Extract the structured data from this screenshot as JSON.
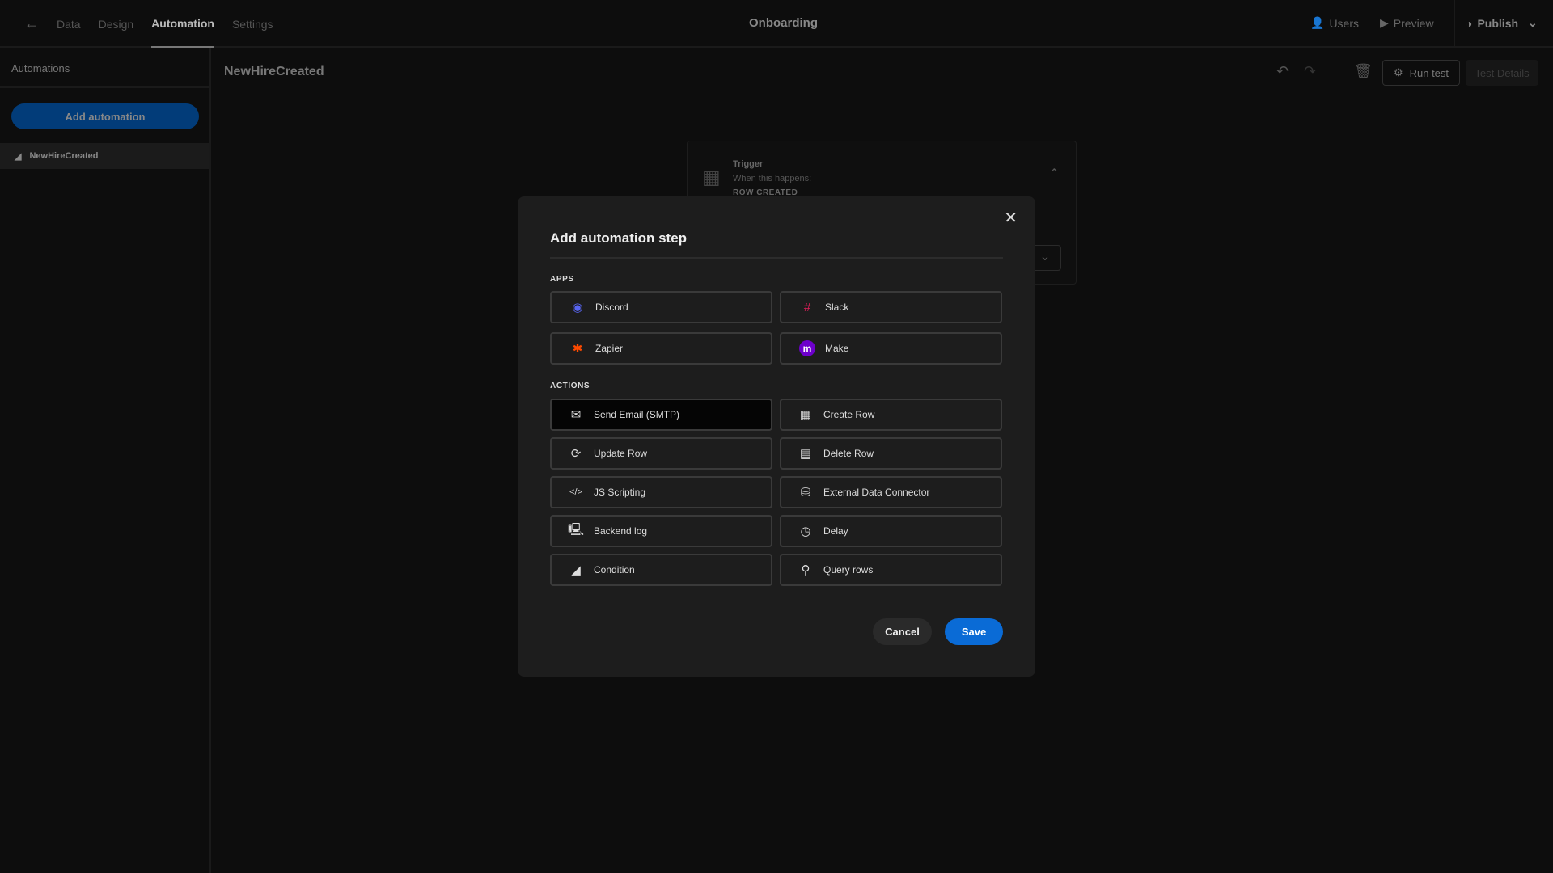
{
  "header": {
    "nav": [
      "Data",
      "Design",
      "Automation",
      "Settings"
    ],
    "active": "Automation",
    "title": "Onboarding",
    "users": "Users",
    "preview": "Preview",
    "publish": "Publish"
  },
  "sidebar": {
    "heading": "Automations",
    "add_button": "Add automation",
    "items": [
      {
        "label": "NewHireCreated"
      }
    ]
  },
  "main": {
    "automation_name": "NewHireCreated",
    "run_test": "Run test",
    "test_details": "Test Details",
    "trigger": {
      "label": "Trigger",
      "subtitle": "When this happens:",
      "event": "ROW CREATED"
    }
  },
  "modal": {
    "title": "Add automation step",
    "apps_label": "APPS",
    "actions_label": "ACTIONS",
    "apps": [
      {
        "label": "Discord",
        "icon": "discord-icon",
        "color": "#5865f2"
      },
      {
        "label": "Slack",
        "icon": "slack-icon",
        "color": "#e01e5a"
      },
      {
        "label": "Zapier",
        "icon": "zapier-icon",
        "color": "#ff4a00"
      },
      {
        "label": "Make",
        "icon": "make-icon",
        "color": "#6d00cc"
      }
    ],
    "actions": [
      {
        "label": "Send Email (SMTP)",
        "icon": "email-icon",
        "selected": true
      },
      {
        "label": "Create Row",
        "icon": "table-add-icon"
      },
      {
        "label": "Update Row",
        "icon": "refresh-icon"
      },
      {
        "label": "Delete Row",
        "icon": "table-remove-icon"
      },
      {
        "label": "JS Scripting",
        "icon": "code-icon"
      },
      {
        "label": "External Data Connector",
        "icon": "database-icon"
      },
      {
        "label": "Backend log",
        "icon": "monitor-icon"
      },
      {
        "label": "Delay",
        "icon": "clock-icon"
      },
      {
        "label": "Condition",
        "icon": "branch-icon"
      },
      {
        "label": "Query rows",
        "icon": "search-icon"
      }
    ],
    "cancel": "Cancel",
    "save": "Save"
  },
  "colors": {
    "accent": "#0a6bd6"
  }
}
